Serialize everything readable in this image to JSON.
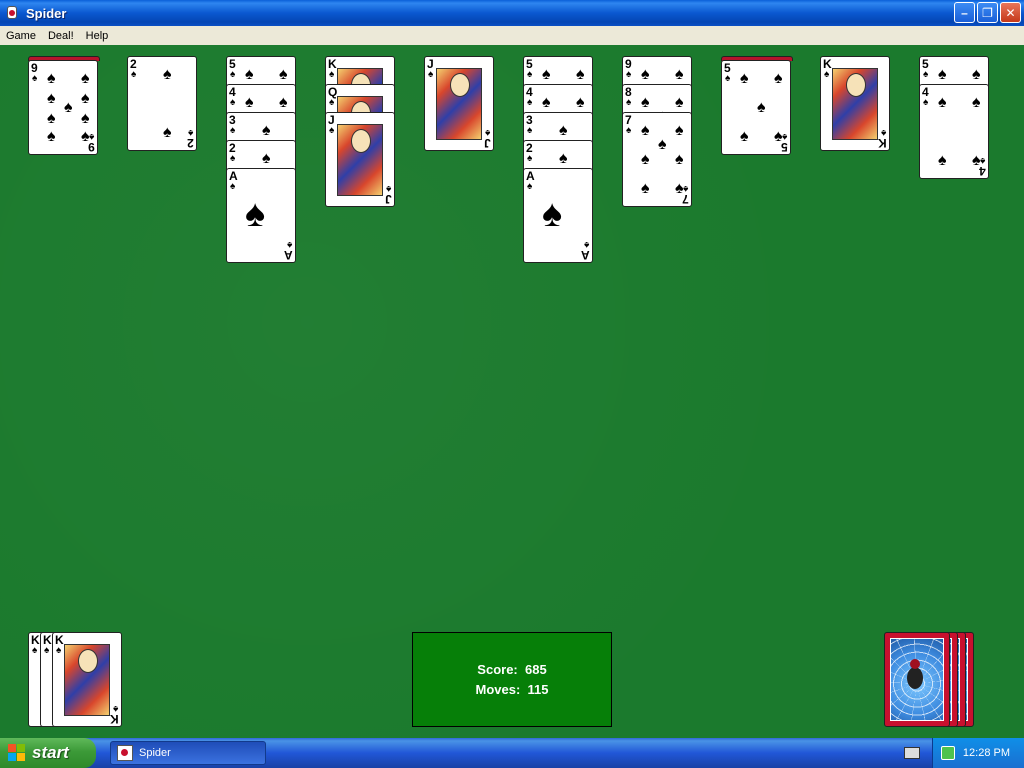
{
  "window": {
    "title": "Spider"
  },
  "menu": [
    "Game",
    "Deal!",
    "Help"
  ],
  "tableau": [
    {
      "has_hidden": true,
      "cards": [
        "9♠"
      ]
    },
    {
      "has_hidden": false,
      "cards": [
        "2♠"
      ]
    },
    {
      "has_hidden": false,
      "cards": [
        "5♠",
        "4♠",
        "3♠",
        "2♠",
        "A♠"
      ]
    },
    {
      "has_hidden": false,
      "cards": [
        "K♠",
        "Q♠",
        "J♠"
      ]
    },
    {
      "has_hidden": false,
      "cards": [
        "J♠"
      ]
    },
    {
      "has_hidden": false,
      "cards": [
        "5♠",
        "4♠",
        "3♠",
        "2♠",
        "A♠"
      ]
    },
    {
      "has_hidden": false,
      "cards": [
        "9♠",
        "8♠",
        "7♠"
      ]
    },
    {
      "has_hidden": true,
      "cards": [
        "5♠"
      ]
    },
    {
      "has_hidden": false,
      "cards": [
        "K♠"
      ]
    },
    {
      "has_hidden": false,
      "cards": [
        "5♠",
        "4♠"
      ]
    }
  ],
  "completed_runs": [
    "K",
    "K",
    "K"
  ],
  "score": {
    "score_label": "Score:",
    "score_value": "685",
    "moves_label": "Moves:",
    "moves_value": "115"
  },
  "stock": {
    "remaining_deals": 4
  },
  "taskbar": {
    "start_label": "start",
    "task_label": "Spider",
    "clock": "12:28 PM"
  },
  "colors": {
    "felt": "#1b7a2d",
    "score_box": "#067f08",
    "card_back": "#c8102e"
  }
}
